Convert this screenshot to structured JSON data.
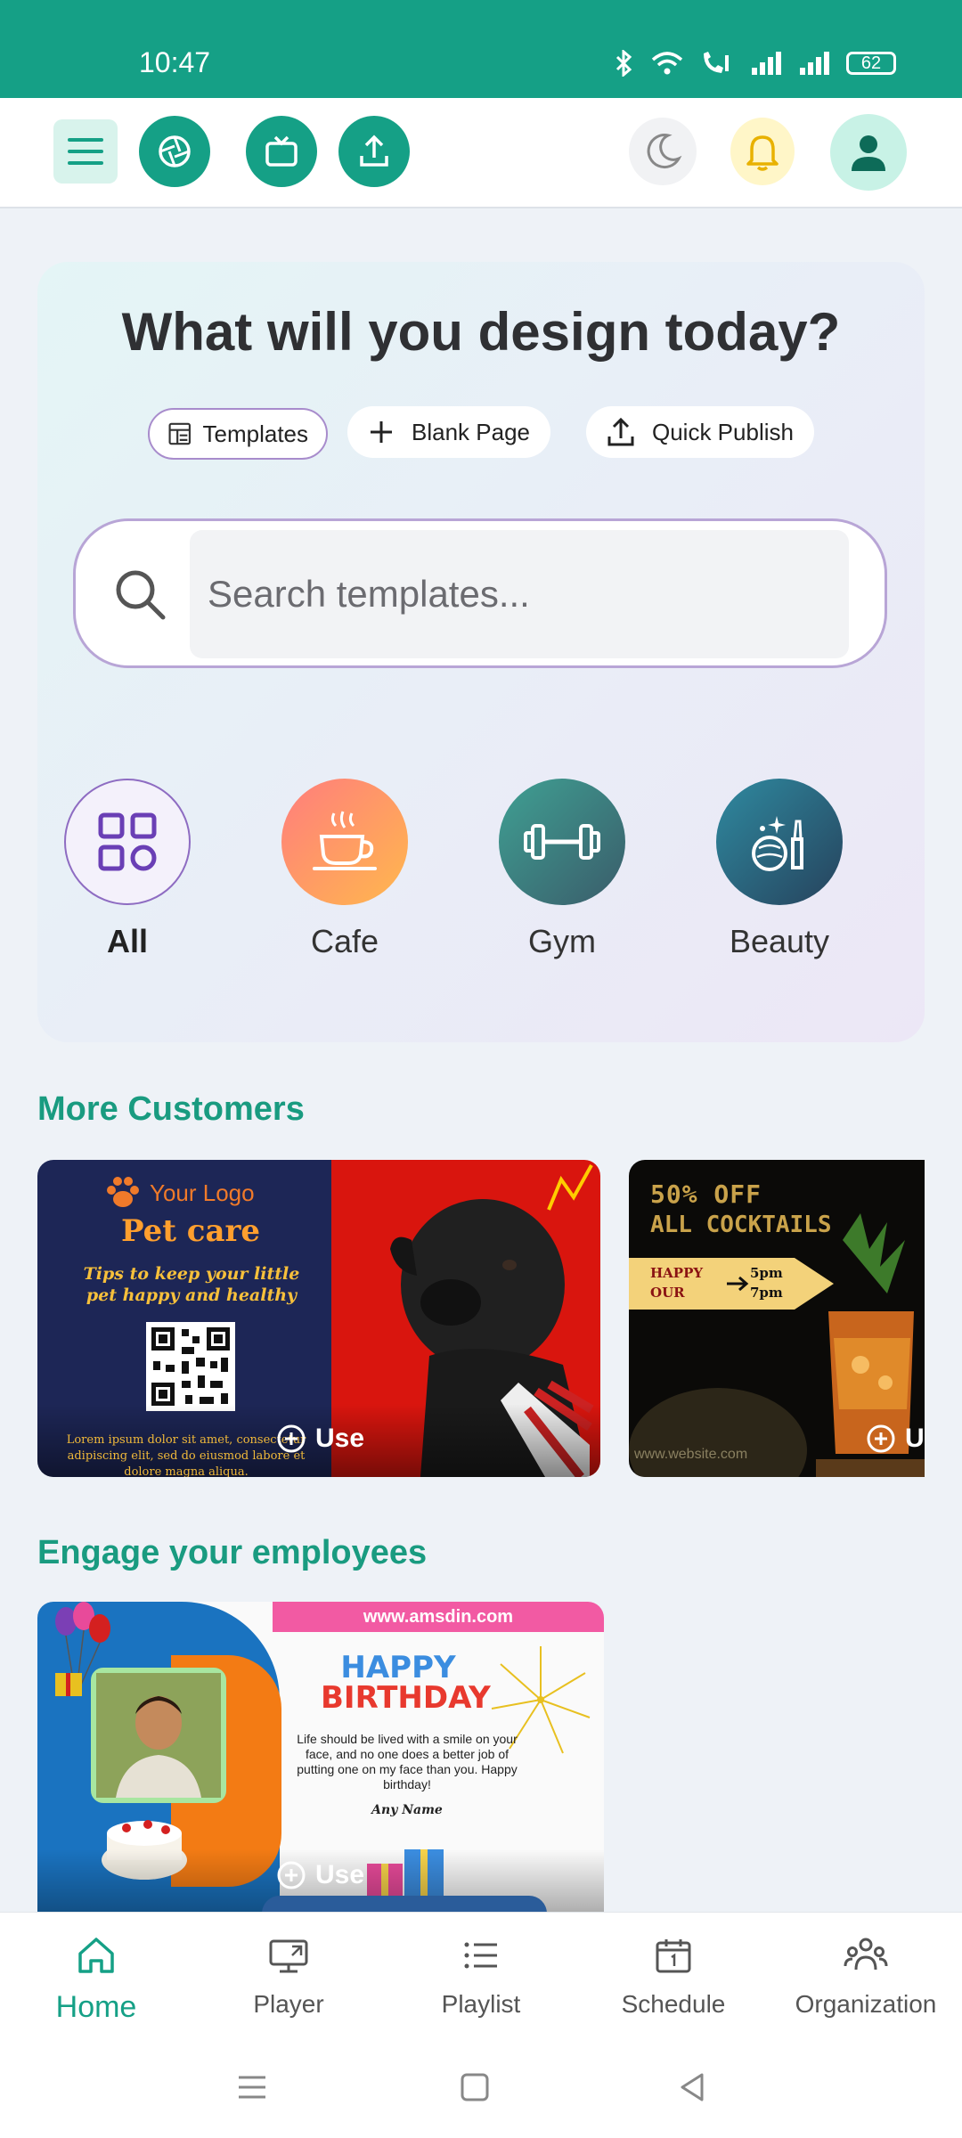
{
  "status": {
    "time": "10:47",
    "battery": "62"
  },
  "hero": {
    "title": "What will you design today?",
    "chips": {
      "templates": "Templates",
      "blank": "Blank Page",
      "publish": "Quick Publish"
    },
    "search_placeholder": "Search templates...",
    "categories": {
      "all": "All",
      "cafe": "Cafe",
      "gym": "Gym",
      "beauty": "Beauty"
    }
  },
  "sections": {
    "more_customers": "More Customers",
    "engage": "Engage your employees"
  },
  "cards": {
    "pet": {
      "logo": "Your Logo",
      "title": "Pet care",
      "tagline": "Tips to keep your little pet happy and healthy",
      "lorem": "Lorem ipsum dolor sit amet, consectetur adipiscing elit, sed do eiusmod labore et dolore magna aliqua.",
      "use": "Use"
    },
    "cocktail": {
      "headline1": "50% OFF",
      "headline2": "ALL COCKTAILS",
      "happy": "HAPPY",
      "hour": "OUR",
      "t1": "5pm",
      "t2": "7pm",
      "site": "www.website.com",
      "use": "U"
    },
    "birthday": {
      "url": "www.amsdin.com",
      "happy": "HAPPY",
      "birthday": "BIRTHDAY",
      "message": "Life should be lived with a smile on your face, and no one does a better job of putting one on my face than you. Happy birthday!",
      "name": "Any Name",
      "use": "Use"
    }
  },
  "nav": {
    "home": "Home",
    "player": "Player",
    "playlist": "Playlist",
    "schedule": "Schedule",
    "organization": "Organization"
  },
  "colors": {
    "primary": "#15a086",
    "accent_purple": "#6a3fb5"
  }
}
